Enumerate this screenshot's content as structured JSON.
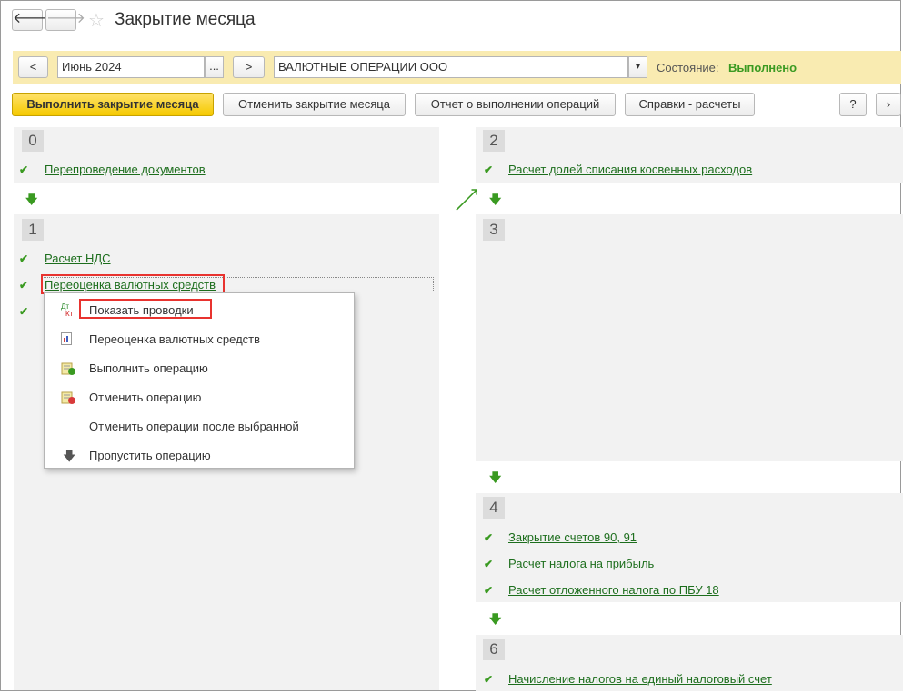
{
  "window": {
    "title": "Закрытие месяца"
  },
  "nav": {
    "back": "🡐",
    "forward": "🡒"
  },
  "period": {
    "prev_label": "<",
    "next_label": ">",
    "value": "Июнь 2024",
    "picker_label": "..."
  },
  "organization": {
    "value": "ВАЛЮТНЫЕ ОПЕРАЦИИ ООО",
    "dropdown_label": "▾"
  },
  "status": {
    "label": "Состояние:",
    "value": "Выполнено",
    "color": "#3a9a21"
  },
  "toolbar": {
    "close_month": "Выполнить закрытие месяца",
    "cancel_close": "Отменить закрытие месяца",
    "report": "Отчет о выполнении операций",
    "help_calc": "Справки - расчеты",
    "help": "?",
    "more": "›"
  },
  "stages": {
    "s0": {
      "num": "0",
      "ops": [
        "Перепроведение документов"
      ]
    },
    "s1": {
      "num": "1",
      "ops": [
        "Расчет НДС",
        "Переоценка валютных средств"
      ]
    },
    "s2": {
      "num": "2",
      "ops": [
        "Расчет долей списания косвенных расходов"
      ]
    },
    "s3": {
      "num": "3"
    },
    "s4": {
      "num": "4",
      "ops": [
        "Закрытие счетов 90, 91",
        "Расчет налога на прибыль",
        "Расчет отложенного налога по ПБУ 18"
      ]
    },
    "s6": {
      "num": "6",
      "ops": [
        "Начисление налогов на единый налоговый счет"
      ]
    }
  },
  "context_menu": {
    "items": [
      {
        "label": "Показать проводки",
        "icon": "dt-kt-icon"
      },
      {
        "label": "Переоценка валютных средств",
        "icon": "report-icon"
      },
      {
        "label": "Выполнить операцию",
        "icon": "execute-icon"
      },
      {
        "label": "Отменить операцию",
        "icon": "cancel-operation-icon"
      },
      {
        "label": "Отменить операции после выбранной",
        "icon": ""
      },
      {
        "label": "Пропустить операцию",
        "icon": "skip-arrow-icon"
      }
    ]
  },
  "icon_text": {
    "dt": "Дт",
    "kt": "Кт"
  },
  "colors": {
    "accent_green": "#3a9a21",
    "link_green": "#1d6e1d",
    "highlight_red": "#e8332f",
    "yellow_bar": "#f9ebb1",
    "primary_yellow": "#f5c900"
  }
}
